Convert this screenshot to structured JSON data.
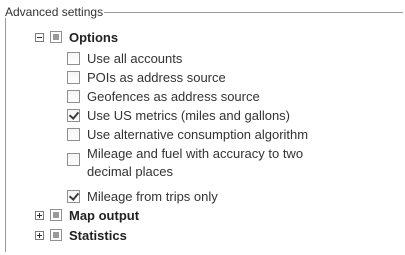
{
  "panel": {
    "title": "Advanced settings"
  },
  "groups": {
    "options": {
      "label": "Options",
      "items": [
        {
          "label": "Use all accounts",
          "checked": false
        },
        {
          "label": "POIs as address source",
          "checked": false
        },
        {
          "label": "Geofences as address source",
          "checked": false
        },
        {
          "label": "Use US metrics (miles and gallons)",
          "checked": true
        },
        {
          "label": "Use alternative consumption algorithm",
          "checked": false
        },
        {
          "label": "Mileage and fuel with accuracy to two decimal places",
          "line1": "Mileage and fuel with accuracy to two",
          "line2": "decimal places",
          "checked": false
        },
        {
          "label": "Mileage from trips only",
          "checked": true
        }
      ]
    },
    "map_output": {
      "label": "Map output"
    },
    "statistics": {
      "label": "Statistics"
    }
  }
}
